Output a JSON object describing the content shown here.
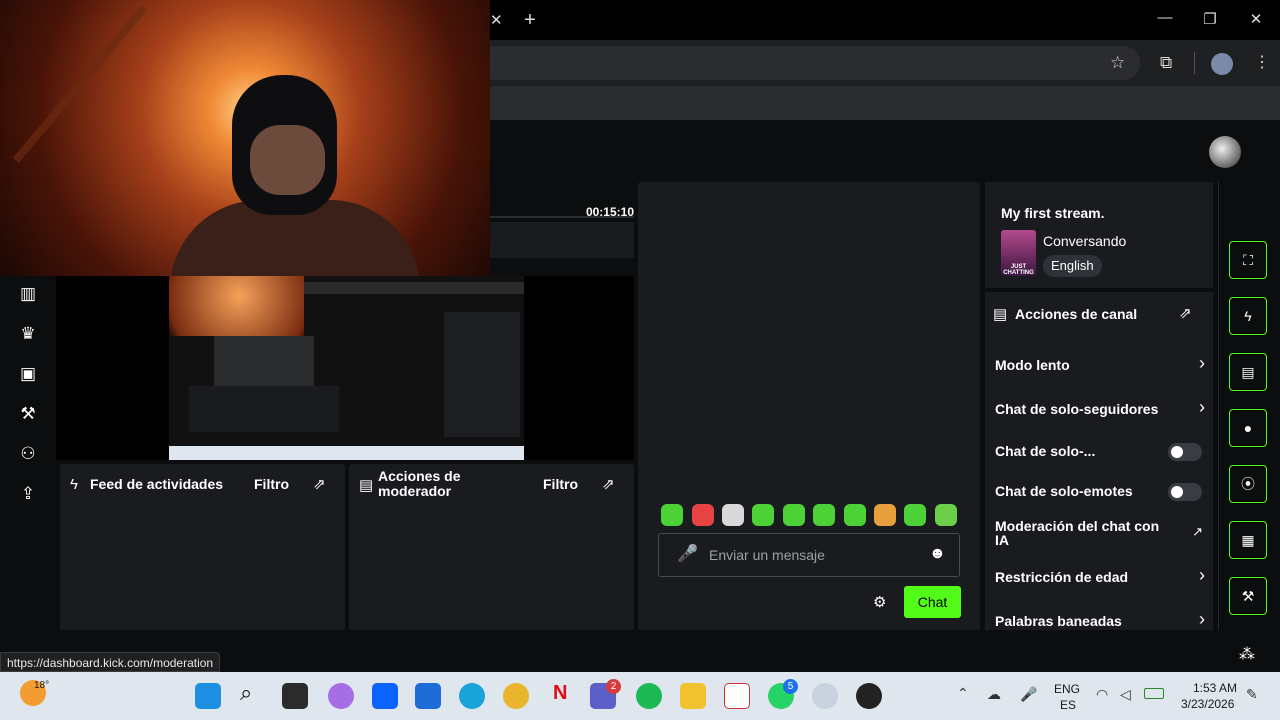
{
  "browser": {
    "new_tab_label": "+",
    "close_tab_label": "✕",
    "window_controls": {
      "minimize": "—",
      "restore": "❐",
      "close": "✕"
    },
    "status_url": "https://dashboard.kick.com/moderation"
  },
  "dashboard": {
    "timer": "00:15:10",
    "stream_info": {
      "title": "My first stream.",
      "category": "Conversando",
      "category_thumb_text": "JUST CHATTING",
      "language": "English"
    },
    "channel_actions": {
      "header": "Acciones de canal",
      "items": [
        {
          "label": "Modo lento",
          "control": "chevron"
        },
        {
          "label": "Chat de solo-seguidores",
          "control": "chevron"
        },
        {
          "label": "Chat de solo-...",
          "control": "toggle"
        },
        {
          "label": "Chat de solo-emotes",
          "control": "toggle"
        },
        {
          "label": "Moderación del chat con IA",
          "control": "external"
        },
        {
          "label": "Restricción de edad",
          "control": "chevron"
        },
        {
          "label": "Palabras baneadas",
          "control": "chevron"
        }
      ]
    },
    "activity_feed": {
      "title": "Feed de actividades",
      "filter": "Filtro"
    },
    "mod_actions": {
      "title": "Acciones de moderador",
      "filter": "Filtro"
    },
    "chat": {
      "placeholder": "Enviar un mensaje",
      "send_label": "Chat"
    },
    "accent_color": "#53fc18",
    "quick_actions": [
      "capture-icon",
      "lightning-icon",
      "notes-icon",
      "chat-bubble-icon",
      "broadcast-icon",
      "layout-icon",
      "wrench-icon"
    ],
    "sidebar_icons": [
      "dashboard-icon",
      "trophy-icon",
      "video-icon",
      "wrench-icon",
      "users-icon",
      "upload-icon"
    ]
  },
  "taskbar": {
    "weather_temp": "18°",
    "teams_badge": "2",
    "whatsapp_badge": "5",
    "lang_top": "ENG",
    "lang_bottom": "ES",
    "time": "1:53 AM",
    "date": "3/23/2026"
  }
}
